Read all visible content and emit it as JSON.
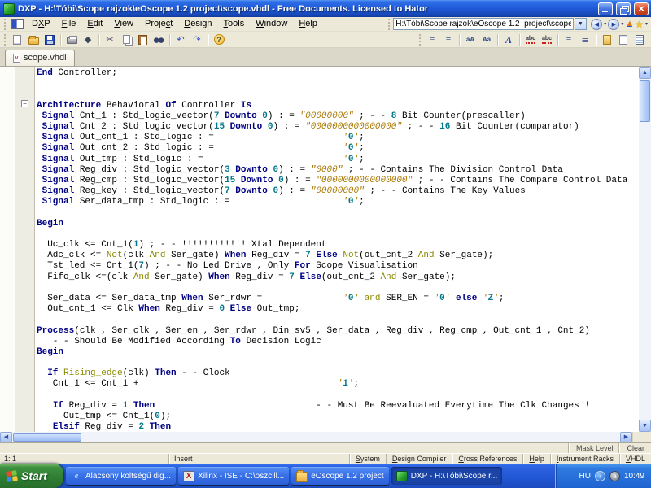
{
  "titlebar": {
    "title": "DXP - H:\\Tóbi\\Scope rajzok\\eOscope 1.2  project\\scope.vhdl - Free Documents. Licensed to Hator"
  },
  "menubar": {
    "items": [
      {
        "label": "DXP",
        "accel": 1
      },
      {
        "label": "File",
        "accel": 0
      },
      {
        "label": "Edit",
        "accel": 0
      },
      {
        "label": "View",
        "accel": 0
      },
      {
        "label": "Project",
        "accel": 5
      },
      {
        "label": "Design",
        "accel": 0
      },
      {
        "label": "Tools",
        "accel": 0
      },
      {
        "label": "Window",
        "accel": 0
      },
      {
        "label": "Help",
        "accel": 0
      }
    ]
  },
  "addressbar": {
    "value": "H:\\Tóbi\\Scope rajzok\\eOscope 1.2  project\\scope.vhdl"
  },
  "nav": [
    {
      "base": "back",
      "glyph": "◀",
      "cls": "nav-circle"
    },
    {
      "base": "back-history",
      "glyph": "▾",
      "cls": "nav-mini"
    },
    {
      "base": "forward",
      "glyph": "▶",
      "cls": "nav-circle"
    },
    {
      "base": "forward-history",
      "glyph": "▾",
      "cls": "nav-mini"
    },
    {
      "base": "up",
      "glyph": "▲",
      "cls": "nav-up"
    },
    {
      "base": "favorites",
      "glyph": "★",
      "cls": "nav-star"
    },
    {
      "base": "favorites-menu",
      "glyph": "▾",
      "cls": "nav-mini"
    }
  ],
  "toolbar_left": [
    {
      "base": "new-document",
      "cls": "i-new"
    },
    {
      "base": "open",
      "cls": "i-open"
    },
    {
      "base": "save",
      "cls": "i-save"
    },
    {
      "sep": true
    },
    {
      "base": "print",
      "cls": "i-print"
    },
    {
      "base": "preview",
      "glyph": "◆",
      "color": "#3A4A5A"
    },
    {
      "sep": true
    },
    {
      "base": "cut",
      "glyph": "✂",
      "color": "#444466"
    },
    {
      "base": "copy",
      "cls": "i-copy"
    },
    {
      "base": "paste",
      "cls": "i-paste"
    },
    {
      "base": "find",
      "cls": "i-find"
    },
    {
      "sep": true
    },
    {
      "base": "undo",
      "glyph": "↶",
      "color": "#2B50C8"
    },
    {
      "base": "redo",
      "glyph": "↷",
      "color": "#2B50C8"
    },
    {
      "sep": true
    },
    {
      "base": "help",
      "glyph": "?",
      "cls": "i-help"
    }
  ],
  "toolbar_right": [
    {
      "base": "indent",
      "glyph": "≡",
      "color": "#5A6A9A"
    },
    {
      "base": "outdent",
      "glyph": "≡",
      "color": "#5A6A9A"
    },
    {
      "sep": true
    },
    {
      "base": "to-lowercase",
      "glyph": "aA",
      "cls": "i-case"
    },
    {
      "base": "to-uppercase",
      "glyph": "Aa",
      "cls": "i-case"
    },
    {
      "sep": true
    },
    {
      "base": "font",
      "glyph": "A",
      "cls": "i-font"
    },
    {
      "sep": true
    },
    {
      "base": "spell-check",
      "glyph": "abc",
      "cls": "i-spell"
    },
    {
      "base": "auto-correct",
      "glyph": "abc",
      "cls": "i-spell"
    },
    {
      "sep": true
    },
    {
      "base": "align-left",
      "glyph": "≡",
      "color": "#5A6A9A"
    },
    {
      "base": "align-justify",
      "glyph": "≣",
      "color": "#5A6A9A"
    },
    {
      "sep": true
    },
    {
      "base": "templates",
      "cls": "i-doc-gold"
    },
    {
      "base": "document",
      "cls": "i-doc-plain"
    },
    {
      "base": "report",
      "cls": "i-doc-blue"
    }
  ],
  "tabs": {
    "active": "scope.vhdl"
  },
  "editor": {
    "syntax_colors": {
      "keyword": "#000084",
      "number": "#00788A",
      "string": "#A87800",
      "operator_word": "#8A8A00",
      "plain": "#000000"
    },
    "lines": [
      {
        "t": [
          [
            "k",
            "End"
          ],
          [
            "p",
            " Controller;"
          ]
        ]
      },
      {
        "t": []
      },
      {
        "t": []
      },
      {
        "t": [
          [
            "k",
            "Architecture"
          ],
          [
            "p",
            " Behavioral "
          ],
          [
            "k",
            "Of"
          ],
          [
            "p",
            " Controller "
          ],
          [
            "k",
            "Is"
          ]
        ]
      },
      {
        "t": [
          [
            "p",
            " "
          ],
          [
            "k",
            "Signal"
          ],
          [
            "p",
            " Cnt_1 : Std_logic_vector("
          ],
          [
            "n",
            "7"
          ],
          [
            "p",
            " "
          ],
          [
            "k",
            "Downto"
          ],
          [
            "p",
            " "
          ],
          [
            "n",
            "0"
          ],
          [
            "p",
            ") : = "
          ],
          [
            "s",
            "\"00000000\""
          ],
          [
            "p",
            " ; - - "
          ],
          [
            "n",
            "8"
          ],
          [
            "p",
            " Bit Counter(prescaller)"
          ]
        ]
      },
      {
        "t": [
          [
            "p",
            " "
          ],
          [
            "k",
            "Signal"
          ],
          [
            "p",
            " Cnt_2 : Std_logic_vector("
          ],
          [
            "n",
            "15"
          ],
          [
            "p",
            " "
          ],
          [
            "k",
            "Downto"
          ],
          [
            "p",
            " "
          ],
          [
            "n",
            "0"
          ],
          [
            "p",
            ") : = "
          ],
          [
            "s",
            "\"0000000000000000\""
          ],
          [
            "p",
            " ; - - "
          ],
          [
            "n",
            "16"
          ],
          [
            "p",
            " Bit Counter(comparator)"
          ]
        ]
      },
      {
        "t": [
          [
            "p",
            " "
          ],
          [
            "k",
            "Signal"
          ],
          [
            "p",
            " Out_cnt_1 : Std_logic : =                        "
          ],
          [
            "s",
            "'"
          ],
          [
            "n",
            "0"
          ],
          [
            "s",
            "'"
          ],
          [
            "p",
            ";"
          ]
        ]
      },
      {
        "t": [
          [
            "p",
            " "
          ],
          [
            "k",
            "Signal"
          ],
          [
            "p",
            " Out_cnt_2 : Std_logic : =                        "
          ],
          [
            "s",
            "'"
          ],
          [
            "n",
            "0"
          ],
          [
            "s",
            "'"
          ],
          [
            "p",
            ";"
          ]
        ]
      },
      {
        "t": [
          [
            "p",
            " "
          ],
          [
            "k",
            "Signal"
          ],
          [
            "p",
            " Out_tmp : Std_logic : =                          "
          ],
          [
            "s",
            "'"
          ],
          [
            "n",
            "0"
          ],
          [
            "s",
            "'"
          ],
          [
            "p",
            ";"
          ]
        ]
      },
      {
        "t": [
          [
            "p",
            " "
          ],
          [
            "k",
            "Signal"
          ],
          [
            "p",
            " Reg_div : Std_logic_vector("
          ],
          [
            "n",
            "3"
          ],
          [
            "p",
            " "
          ],
          [
            "k",
            "Downto"
          ],
          [
            "p",
            " "
          ],
          [
            "n",
            "0"
          ],
          [
            "p",
            ") : = "
          ],
          [
            "s",
            "\"0000\""
          ],
          [
            "p",
            " ; - - Contains The Division Control Data"
          ]
        ]
      },
      {
        "t": [
          [
            "p",
            " "
          ],
          [
            "k",
            "Signal"
          ],
          [
            "p",
            " Reg_cmp : Std_logic_vector("
          ],
          [
            "n",
            "15"
          ],
          [
            "p",
            " "
          ],
          [
            "k",
            "Downto"
          ],
          [
            "p",
            " "
          ],
          [
            "n",
            "0"
          ],
          [
            "p",
            ") : = "
          ],
          [
            "s",
            "\"0000000000000000\""
          ],
          [
            "p",
            " ; - - Contains The Compare Control Data"
          ]
        ]
      },
      {
        "t": [
          [
            "p",
            " "
          ],
          [
            "k",
            "Signal"
          ],
          [
            "p",
            " Reg_key : Std_logic_vector("
          ],
          [
            "n",
            "7"
          ],
          [
            "p",
            " "
          ],
          [
            "k",
            "Downto"
          ],
          [
            "p",
            " "
          ],
          [
            "n",
            "0"
          ],
          [
            "p",
            ") : = "
          ],
          [
            "s",
            "\"00000000\""
          ],
          [
            "p",
            " ; - - Contains The Key Values"
          ]
        ]
      },
      {
        "t": [
          [
            "p",
            " "
          ],
          [
            "k",
            "Signal"
          ],
          [
            "p",
            " Ser_data_tmp : Std_logic : =                     "
          ],
          [
            "s",
            "'"
          ],
          [
            "n",
            "0"
          ],
          [
            "s",
            "'"
          ],
          [
            "p",
            ";"
          ]
        ]
      },
      {
        "t": []
      },
      {
        "t": [
          [
            "k",
            "Begin"
          ]
        ]
      },
      {
        "t": []
      },
      {
        "t": [
          [
            "p",
            "  Uc_clk <= Cnt_1("
          ],
          [
            "n",
            "1"
          ],
          [
            "p",
            ") ; - - !!!!!!!!!!!! Xtal Dependent"
          ]
        ]
      },
      {
        "t": [
          [
            "p",
            "  Adc_clk <= "
          ],
          [
            "f",
            "Not"
          ],
          [
            "p",
            "(clk "
          ],
          [
            "f",
            "And"
          ],
          [
            "p",
            " Ser_gate) "
          ],
          [
            "k",
            "When"
          ],
          [
            "p",
            " Reg_div = "
          ],
          [
            "n",
            "7"
          ],
          [
            "p",
            " "
          ],
          [
            "k",
            "Else"
          ],
          [
            "p",
            " "
          ],
          [
            "f",
            "Not"
          ],
          [
            "p",
            "(out_cnt_2 "
          ],
          [
            "f",
            "And"
          ],
          [
            "p",
            " Ser_gate);"
          ]
        ]
      },
      {
        "t": [
          [
            "p",
            "  Tst_led <= Cnt_1("
          ],
          [
            "n",
            "7"
          ],
          [
            "p",
            ") ; - - No Led Drive , Only "
          ],
          [
            "k",
            "For"
          ],
          [
            "p",
            " Scope Visualisation"
          ]
        ]
      },
      {
        "t": [
          [
            "p",
            "  Fifo_clk <=(clk "
          ],
          [
            "f",
            "And"
          ],
          [
            "p",
            " Ser_gate) "
          ],
          [
            "k",
            "When"
          ],
          [
            "p",
            " Reg_div = "
          ],
          [
            "n",
            "7"
          ],
          [
            "p",
            " "
          ],
          [
            "k",
            "Else"
          ],
          [
            "p",
            "(out_cnt_2 "
          ],
          [
            "f",
            "And"
          ],
          [
            "p",
            " Ser_gate);"
          ]
        ]
      },
      {
        "t": []
      },
      {
        "t": [
          [
            "p",
            "  Ser_data <= Ser_data_tmp "
          ],
          [
            "k",
            "When"
          ],
          [
            "p",
            " Ser_rdwr =               "
          ],
          [
            "s",
            "'"
          ],
          [
            "n",
            "0"
          ],
          [
            "s",
            "'"
          ],
          [
            "p",
            " "
          ],
          [
            "f",
            "and"
          ],
          [
            "p",
            " SER_EN = "
          ],
          [
            "s",
            "'"
          ],
          [
            "n",
            "0"
          ],
          [
            "s",
            "'"
          ],
          [
            "p",
            " "
          ],
          [
            "k",
            "else"
          ],
          [
            "p",
            " "
          ],
          [
            "s",
            "'"
          ],
          [
            "n",
            "Z"
          ],
          [
            "s",
            "'"
          ],
          [
            "p",
            ";"
          ]
        ]
      },
      {
        "t": [
          [
            "p",
            "  Out_cnt_1 <= Clk "
          ],
          [
            "k",
            "When"
          ],
          [
            "p",
            " Reg_div = "
          ],
          [
            "n",
            "0"
          ],
          [
            "p",
            " "
          ],
          [
            "k",
            "Else"
          ],
          [
            "p",
            " Out_tmp;"
          ]
        ]
      },
      {
        "t": []
      },
      {
        "t": [
          [
            "k",
            "Process"
          ],
          [
            "p",
            "(clk , Ser_clk , Ser_en , Ser_rdwr , Din_sv5 , Ser_data , Reg_div , Reg_cmp , Out_cnt_1 , Cnt_2)"
          ]
        ]
      },
      {
        "t": [
          [
            "p",
            "   - - Should Be Modified According "
          ],
          [
            "k",
            "To"
          ],
          [
            "p",
            " Decision Logic"
          ]
        ]
      },
      {
        "t": [
          [
            "k",
            "Begin"
          ]
        ]
      },
      {
        "t": []
      },
      {
        "t": [
          [
            "p",
            "  "
          ],
          [
            "k",
            "If"
          ],
          [
            "p",
            " "
          ],
          [
            "f",
            "Rising_edge"
          ],
          [
            "p",
            "(clk) "
          ],
          [
            "k",
            "Then"
          ],
          [
            "p",
            " - - Clock"
          ]
        ]
      },
      {
        "t": [
          [
            "p",
            "   Cnt_1 <= Cnt_1 +                                     "
          ],
          [
            "s",
            "'"
          ],
          [
            "n",
            "1"
          ],
          [
            "s",
            "'"
          ],
          [
            "p",
            ";"
          ]
        ]
      },
      {
        "t": []
      },
      {
        "t": [
          [
            "p",
            "   "
          ],
          [
            "k",
            "If"
          ],
          [
            "p",
            " Reg_div = "
          ],
          [
            "n",
            "1"
          ],
          [
            "p",
            " "
          ],
          [
            "k",
            "Then"
          ],
          [
            "p",
            "                              - - Must Be Reevaluated Everytime The Clk Changes !"
          ]
        ]
      },
      {
        "t": [
          [
            "p",
            "     Out_tmp <= Cnt_1("
          ],
          [
            "n",
            "0"
          ],
          [
            "p",
            ");"
          ]
        ]
      },
      {
        "t": [
          [
            "p",
            "   "
          ],
          [
            "k",
            "Elsif"
          ],
          [
            "p",
            " Reg_div = "
          ],
          [
            "n",
            "2"
          ],
          [
            "p",
            " "
          ],
          [
            "k",
            "Then"
          ]
        ]
      }
    ]
  },
  "fold_marker": "−",
  "maskrow": {
    "mask_level": "Mask Level",
    "clear": "Clear"
  },
  "statusbar": {
    "position": "1: 1",
    "mode": "Insert",
    "panels": [
      {
        "label": "System",
        "accel": 0
      },
      {
        "label": "Design Compiler",
        "accel": 0
      },
      {
        "label": "Cross References",
        "accel": 0
      },
      {
        "label": "Help",
        "accel": 0
      },
      {
        "label": "Instrument Racks",
        "accel": 0
      },
      {
        "label": "VHDL",
        "accel": 0
      }
    ]
  },
  "taskbar": {
    "start_label": "Start",
    "buttons": [
      {
        "base": "taskbar-ie",
        "label": "Alacsony költségű dig...",
        "icon": "ti-ie",
        "glyph": "e",
        "active": false
      },
      {
        "base": "taskbar-xilinx",
        "label": "Xilinx - ISE - C:\\oszcill...",
        "icon": "ti-xilinx",
        "glyph": "X",
        "active": false
      },
      {
        "base": "taskbar-eoscope",
        "label": "eOscope 1.2  project",
        "icon": "ti-folder",
        "glyph": "",
        "active": false
      },
      {
        "base": "taskbar-dxp",
        "label": "DXP - H:\\Tóbi\\Scope r...",
        "icon": "ti-dxp",
        "glyph": "",
        "active": true
      }
    ],
    "tray": {
      "lang": "HU",
      "chevron": "‹",
      "icon_glyph": "a",
      "time": "10:49"
    }
  }
}
